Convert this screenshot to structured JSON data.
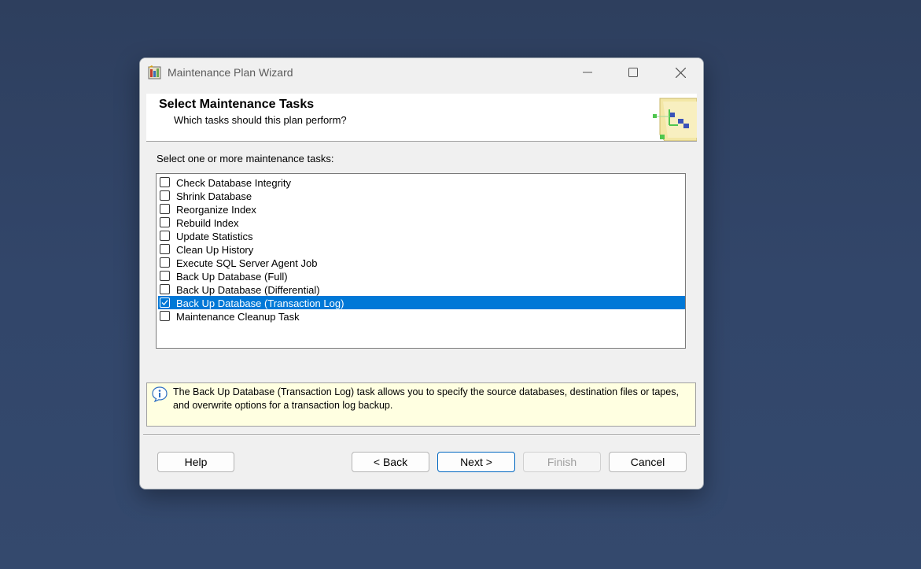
{
  "window": {
    "title": "Maintenance Plan Wizard",
    "app_icon": "wizard-app-icon",
    "controls": {
      "minimize": "minimize-icon",
      "maximize": "maximize-icon",
      "close": "close-icon"
    }
  },
  "header": {
    "title": "Select Maintenance Tasks",
    "subtitle": "Which tasks should this plan perform?",
    "graphic": "wizard-header-graphic"
  },
  "prompt": "Select one or more maintenance tasks:",
  "tasks": [
    {
      "label": "Check Database Integrity",
      "checked": false,
      "selected": false
    },
    {
      "label": "Shrink Database",
      "checked": false,
      "selected": false
    },
    {
      "label": "Reorganize Index",
      "checked": false,
      "selected": false
    },
    {
      "label": "Rebuild Index",
      "checked": false,
      "selected": false
    },
    {
      "label": "Update Statistics",
      "checked": false,
      "selected": false
    },
    {
      "label": "Clean Up History",
      "checked": false,
      "selected": false
    },
    {
      "label": "Execute SQL Server Agent Job",
      "checked": false,
      "selected": false
    },
    {
      "label": "Back Up Database (Full)",
      "checked": false,
      "selected": false
    },
    {
      "label": "Back Up Database (Differential)",
      "checked": false,
      "selected": false
    },
    {
      "label": "Back Up Database (Transaction Log)",
      "checked": true,
      "selected": true
    },
    {
      "label": "Maintenance Cleanup Task",
      "checked": false,
      "selected": false
    }
  ],
  "info": {
    "icon": "info-icon",
    "text": "The Back Up Database (Transaction Log) task allows you to specify the source databases, destination files or tapes, and overwrite options for a transaction log backup."
  },
  "buttons": {
    "help": "Help",
    "back": "< Back",
    "next": "Next >",
    "finish": "Finish",
    "cancel": "Cancel"
  },
  "colors": {
    "selection": "#0078d7",
    "info_background": "#ffffe1",
    "desktop": "#2f4266"
  }
}
